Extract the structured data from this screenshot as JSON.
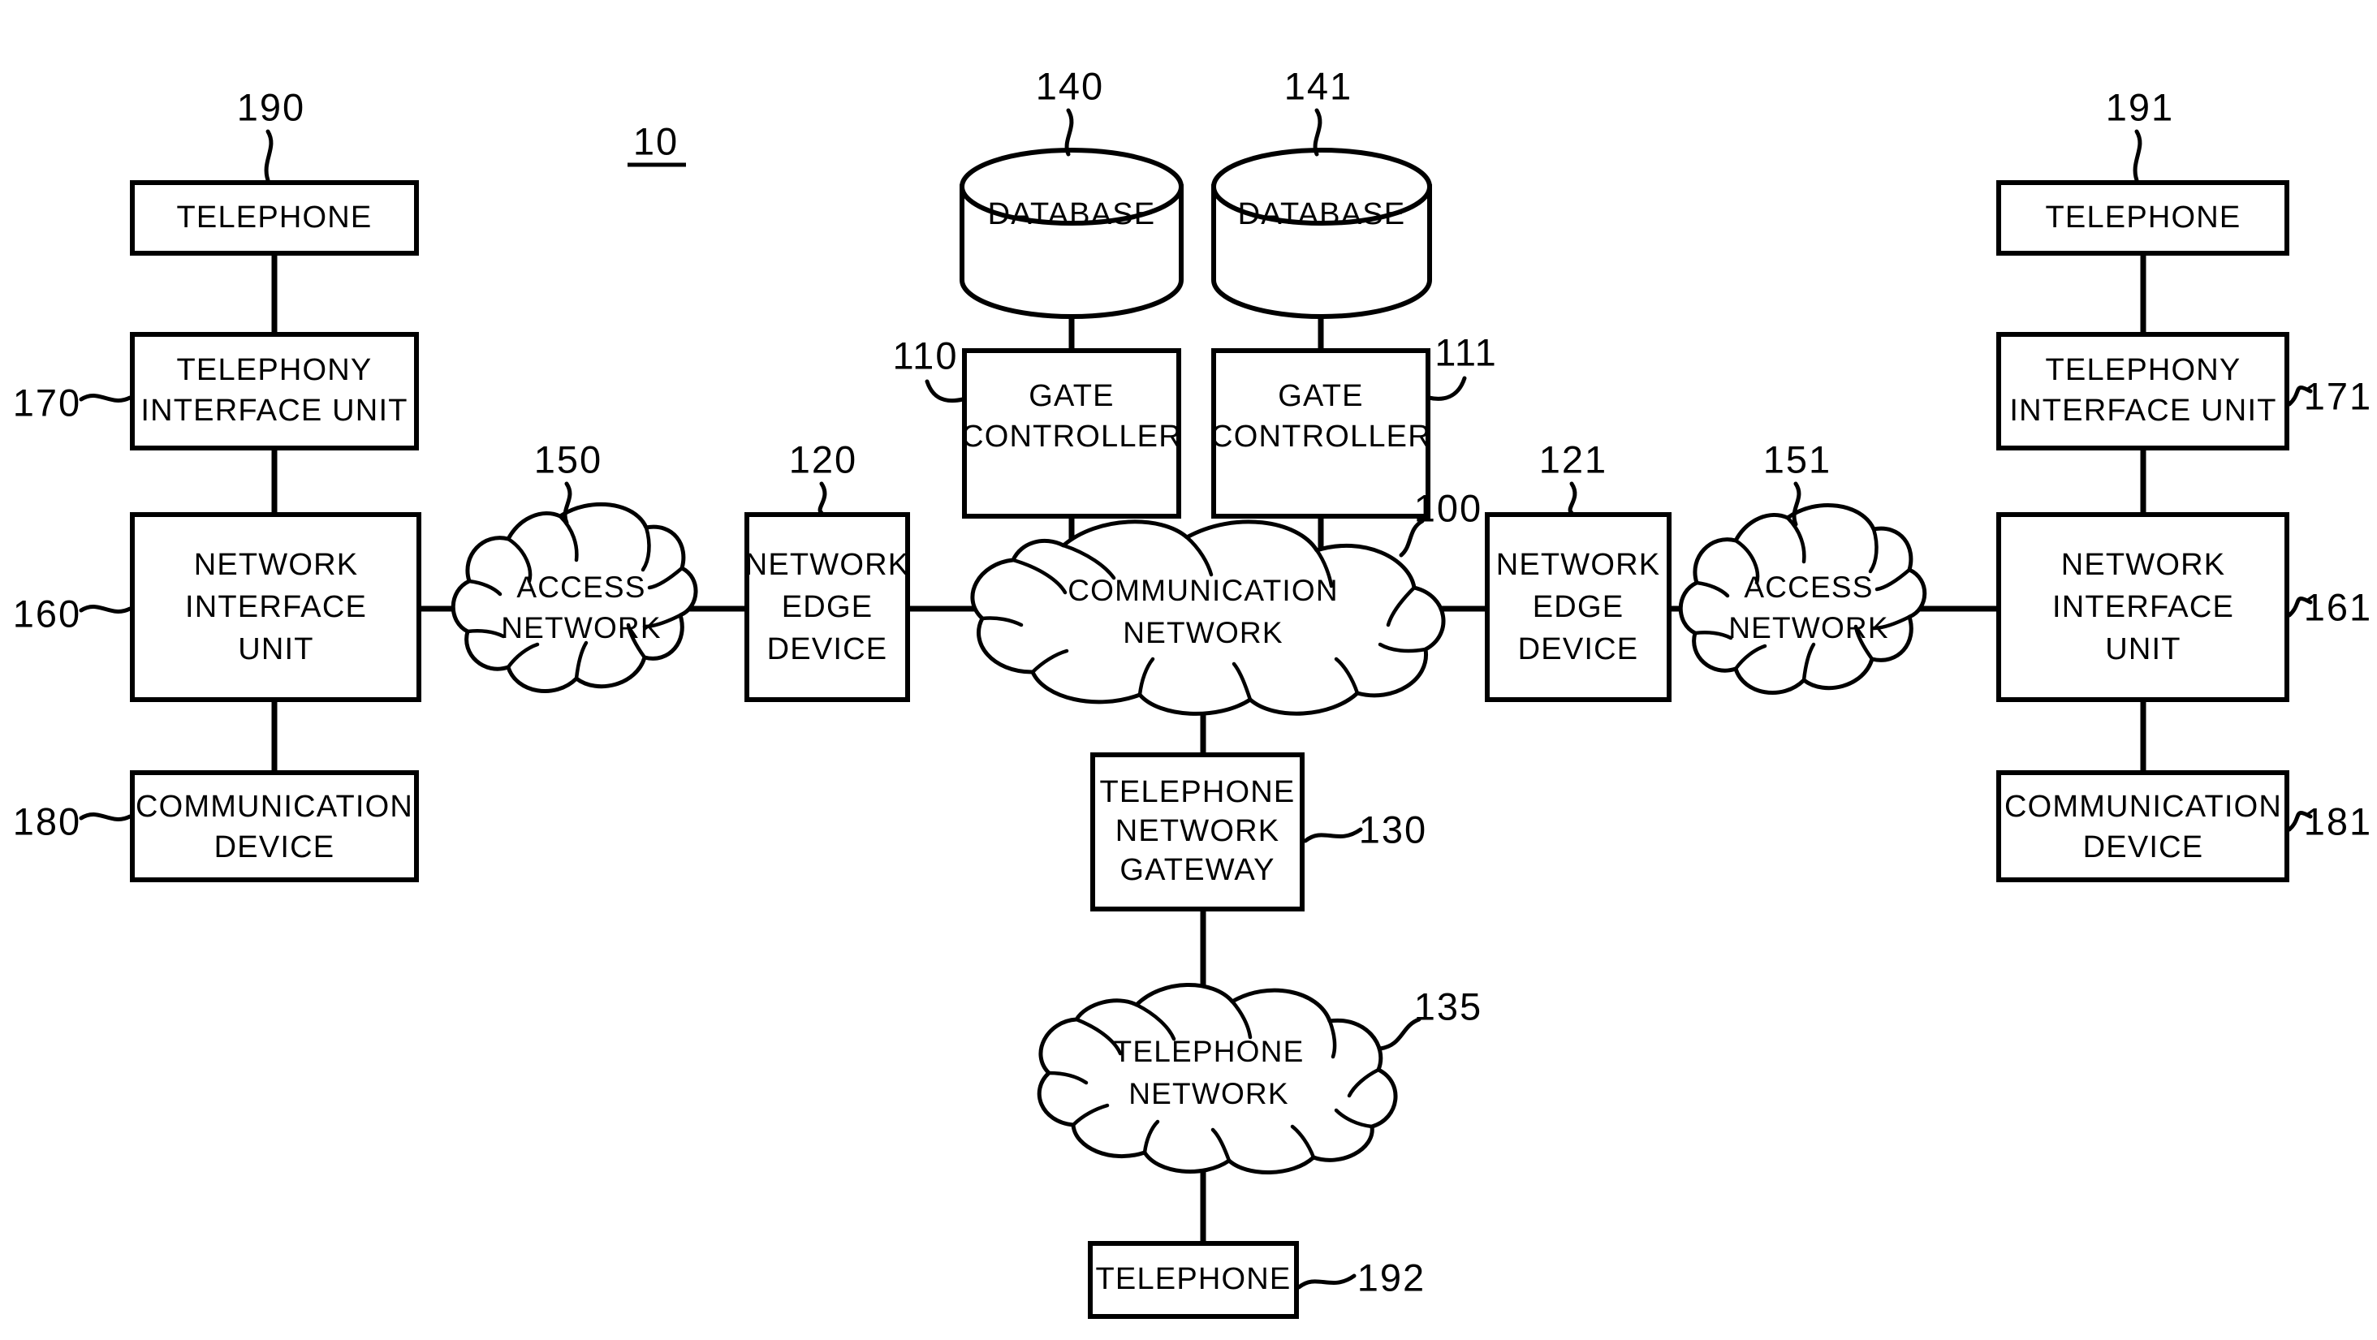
{
  "figure": {
    "figure_number": "10",
    "background_color": "#ffffff",
    "line_color": "#000000"
  },
  "nodes": {
    "telephone_left": {
      "label": "TELEPHONE",
      "ref": "190"
    },
    "telephony_interface_left": {
      "line1": "TELEPHONY",
      "line2": "INTERFACE  UNIT",
      "ref": "170"
    },
    "network_interface_left": {
      "line1": "NETWORK",
      "line2": "INTERFACE",
      "line3": "UNIT",
      "ref": "160"
    },
    "communication_device_left": {
      "line1": "COMMUNICATION",
      "line2": "DEVICE",
      "ref": "180"
    },
    "access_network_left": {
      "line1": "ACCESS",
      "line2": "NETWORK",
      "ref": "150"
    },
    "network_edge_left": {
      "line1": "NETWORK",
      "line2": "EDGE",
      "line3": "DEVICE",
      "ref": "120"
    },
    "database_left": {
      "label": "DATABASE",
      "ref": "140"
    },
    "database_right": {
      "label": "DATABASE",
      "ref": "141"
    },
    "gate_controller_left": {
      "line1": "GATE",
      "line2": "CONTROLLER",
      "ref": "110"
    },
    "gate_controller_right": {
      "line1": "GATE",
      "line2": "CONTROLLER",
      "ref": "111"
    },
    "communication_network": {
      "line1": "COMMUNICATION",
      "line2": "NETWORK",
      "ref": "100"
    },
    "telephone_network_gateway": {
      "line1": "TELEPHONE",
      "line2": "NETWORK",
      "line3": "GATEWAY",
      "ref": "130"
    },
    "telephone_network": {
      "line1": "TELEPHONE",
      "line2": "NETWORK",
      "ref": "135"
    },
    "telephone_bottom": {
      "label": "TELEPHONE",
      "ref": "192"
    },
    "network_edge_right": {
      "line1": "NETWORK",
      "line2": "EDGE",
      "line3": "DEVICE",
      "ref": "121"
    },
    "access_network_right": {
      "line1": "ACCESS",
      "line2": "NETWORK",
      "ref": "151"
    },
    "telephone_right": {
      "label": "TELEPHONE",
      "ref": "191"
    },
    "telephony_interface_right": {
      "line1": "TELEPHONY",
      "line2": "INTERFACE  UNIT",
      "ref": "171"
    },
    "network_interface_right": {
      "line1": "NETWORK",
      "line2": "INTERFACE",
      "line3": "UNIT",
      "ref": "161"
    },
    "communication_device_right": {
      "line1": "COMMUNICATION",
      "line2": "DEVICE",
      "ref": "181"
    }
  }
}
